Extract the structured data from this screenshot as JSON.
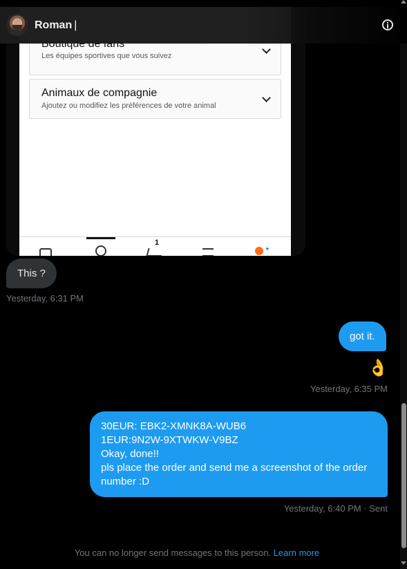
{
  "header": {
    "contact_name": "Roman",
    "name_cursor": "|",
    "avatar_icon": "profile-photo",
    "info_icon": "info-circle-icon"
  },
  "attachment": {
    "cards": [
      {
        "title": "Boutique de fans",
        "subtitle": "Les équipes sportives que vous suivez"
      },
      {
        "title": "Animaux de compagnie",
        "subtitle": "Ajoutez ou modifiez les préférences de votre animal"
      }
    ],
    "cart_count": "1",
    "nav_icons": [
      "home-icon",
      "user-icon",
      "cart-icon",
      "menu-icon",
      "alexa-icon"
    ]
  },
  "messages": [
    {
      "direction": "in",
      "text": "This ?",
      "timestamp": "Yesterday, 6:31 PM"
    },
    {
      "direction": "out",
      "text": "got it."
    },
    {
      "direction": "out",
      "text": "👌",
      "timestamp": "Yesterday, 6:35 PM"
    },
    {
      "direction": "out",
      "lines": [
        "30EUR: EBK2-XMNK8A-WUB6",
        "1EUR:9N2W-9XTWKW-V9BZ",
        "Okay, done!!",
        "pls place the order and send me a screenshot of the order",
        "number :D"
      ],
      "timestamp": "Yesterday, 6:40 PM · Sent"
    }
  ],
  "footer": {
    "notice": "You can no longer send messages to this person.",
    "link": "Learn more"
  },
  "colors": {
    "accent": "#1d9bf0",
    "incoming_bubble": "#2f3336",
    "background": "#000000",
    "muted_text": "#71767b"
  }
}
